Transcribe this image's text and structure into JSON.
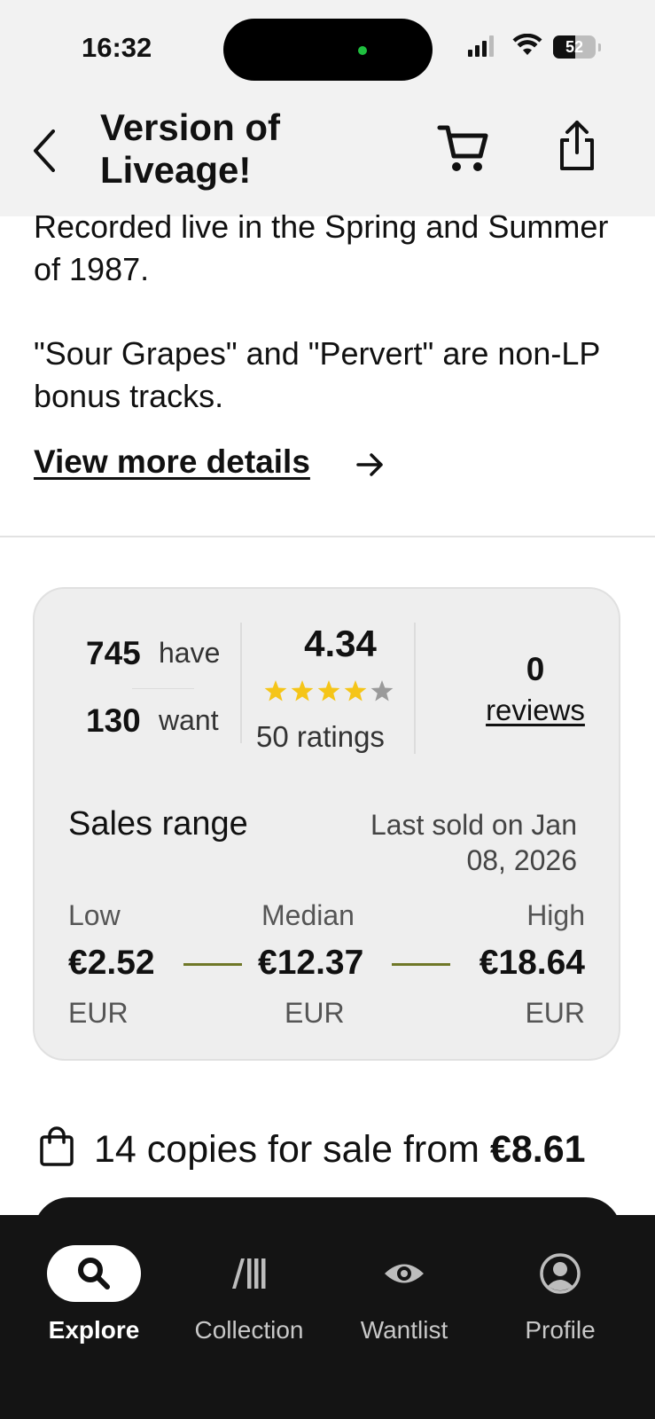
{
  "status_bar": {
    "time": "16:32",
    "battery": "52",
    "battery_level": 0.52
  },
  "header": {
    "title_line1": "Version of",
    "title_line2": "Liveage!",
    "back_icon": "chevron-left-icon",
    "cart_icon": "cart-icon",
    "share_icon": "share-icon"
  },
  "description": {
    "paragraph1": "Recorded live in the Spring and Summer of 1987.",
    "paragraph2": "\"Sour Grapes\" and \"Pervert\" are non-LP bonus tracks."
  },
  "view_more": {
    "label": "View more details",
    "icon": "arrow-right-icon"
  },
  "stats": {
    "have_count": "745",
    "have_label": "have",
    "want_count": "130",
    "want_label": "want",
    "rating": "4.34",
    "rating_stars": 4.34,
    "ratings_label": "50 ratings",
    "reviews_count": "0",
    "reviews_label": "reviews"
  },
  "sales_range": {
    "heading": "Sales range",
    "last_sold": "Last sold on Jan 08, 2026",
    "low": {
      "label": "Low",
      "price": "€2.52",
      "currency": "EUR"
    },
    "median": {
      "label": "Median",
      "price": "€12.37",
      "currency": "EUR"
    },
    "high": {
      "label": "High",
      "price": "€18.64",
      "currency": "EUR"
    },
    "accent_color": "#6f7727"
  },
  "for_sale": {
    "text": "14 copies for sale from ",
    "price": "€8.61",
    "icon": "shopping-bag-icon"
  },
  "bottom_nav": {
    "items": [
      {
        "label": "Explore",
        "icon": "search-icon",
        "active": true
      },
      {
        "label": "Collection",
        "icon": "collection-icon",
        "active": false
      },
      {
        "label": "Wantlist",
        "icon": "eye-icon",
        "active": false
      },
      {
        "label": "Profile",
        "icon": "profile-icon",
        "active": false
      }
    ]
  },
  "colors": {
    "star": "#f5c518",
    "star_empty": "#9a9a9a",
    "nav_bg": "#141414"
  }
}
